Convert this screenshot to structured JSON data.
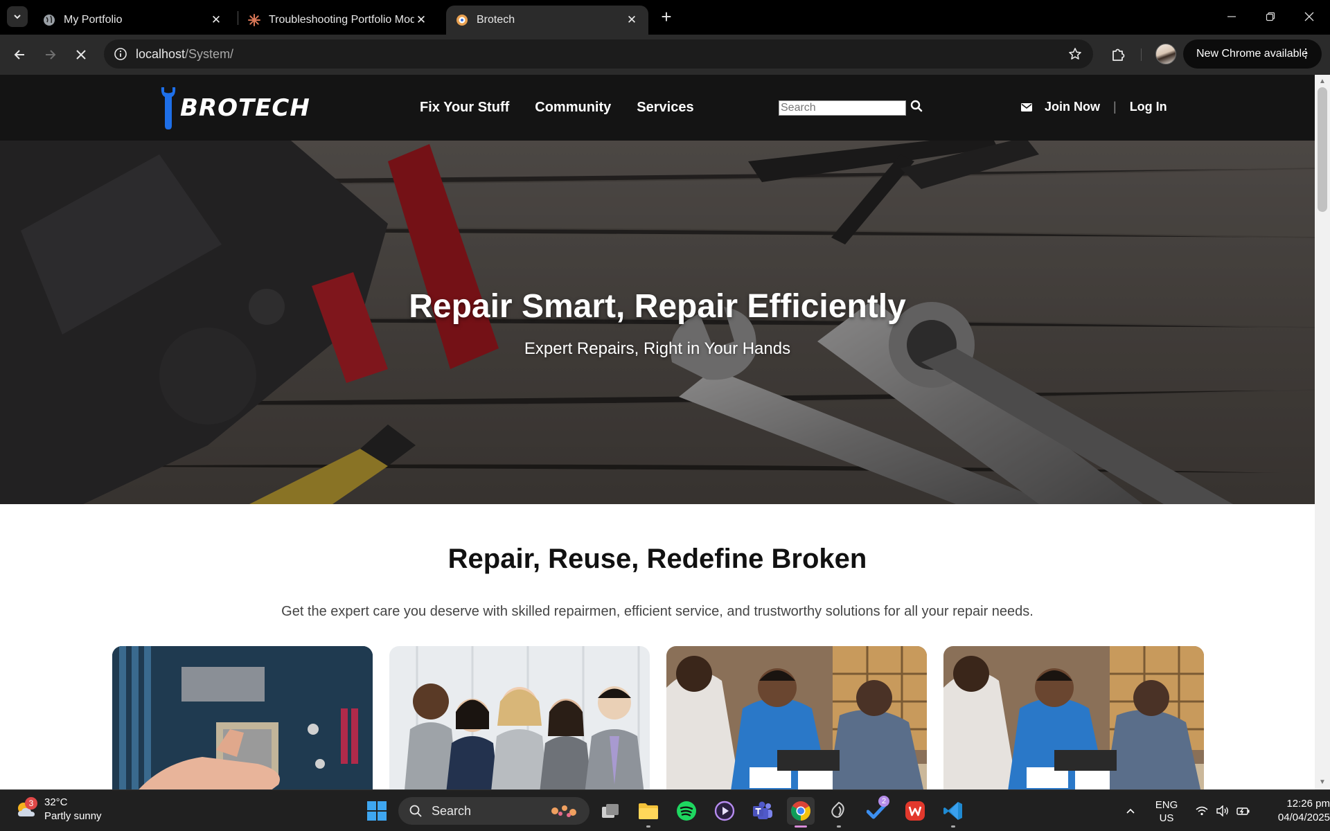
{
  "browser": {
    "tabs": [
      {
        "title": "My Portfolio",
        "icon": "globe-icon",
        "active": false
      },
      {
        "title": "Troubleshooting Portfolio Mod",
        "icon": "claude-sparkle-icon",
        "active": false
      },
      {
        "title": "Brotech",
        "icon": "brotech-favicon-icon",
        "active": true
      }
    ],
    "url_host": "localhost",
    "url_path": "/System/",
    "update_label": "New Chrome available"
  },
  "site": {
    "logo_text": "BROTECH",
    "nav": [
      {
        "label": "Fix Your Stuff"
      },
      {
        "label": "Community"
      },
      {
        "label": "Services"
      }
    ],
    "search_placeholder": "Search",
    "join_label": "Join Now",
    "separator": "|",
    "login_label": "Log In",
    "hero": {
      "title": "Repair Smart, Repair Efficiently",
      "subtitle": "Expert Repairs, Right in Your Hands"
    },
    "intro": {
      "title": "Repair, Reuse, Redefine Broken",
      "text": "Get the expert care you deserve with skilled repairmen, efficient service, and trustworthy solutions for all your repair needs."
    },
    "cards": [
      {
        "image": "motherboard-repair-photo"
      },
      {
        "image": "business-team-photo"
      },
      {
        "image": "technicians-workbench-photo"
      },
      {
        "image": "technicians-workbench-photo"
      }
    ]
  },
  "taskbar": {
    "weather": {
      "temp": "32°C",
      "condition": "Partly sunny",
      "badge": "3"
    },
    "search_label": "Search",
    "todo_badge": "2",
    "lang_line1": "ENG",
    "lang_line2": "US",
    "time": "12:26 pm",
    "date": "04/04/2025"
  },
  "colors": {
    "site_header_bg": "#141414",
    "logo_blue": "#1e6fe8",
    "browser_chrome": "#2b2b2b"
  }
}
